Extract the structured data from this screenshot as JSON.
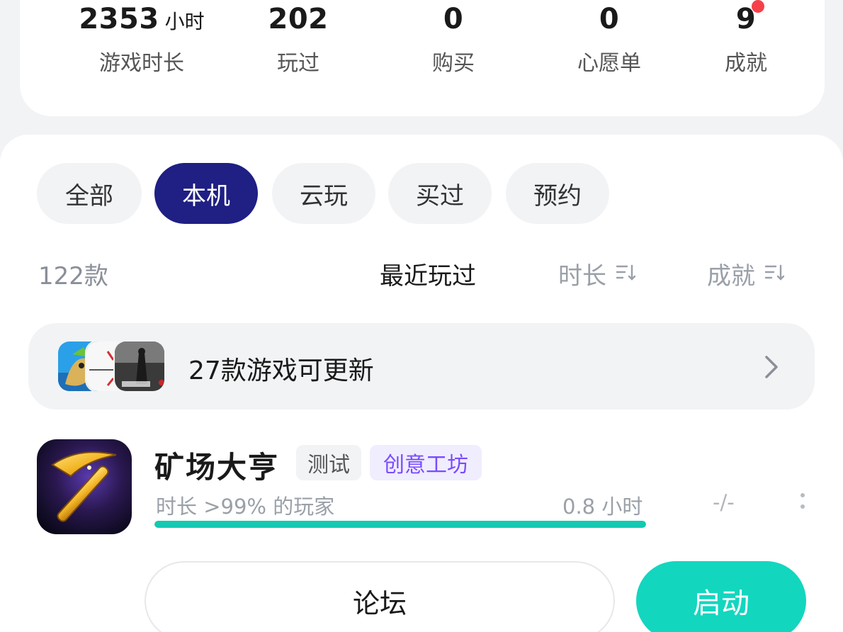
{
  "stats": [
    {
      "value": "2353",
      "unit": "小时",
      "label": "游戏时长"
    },
    {
      "value": "202",
      "unit": "",
      "label": "玩过"
    },
    {
      "value": "0",
      "unit": "",
      "label": "购买"
    },
    {
      "value": "0",
      "unit": "",
      "label": "心愿单"
    },
    {
      "value": "9",
      "unit": "",
      "label": "成就",
      "has_notification_dot": true
    }
  ],
  "tabs": [
    {
      "label": "全部",
      "active": false
    },
    {
      "label": "本机",
      "active": true
    },
    {
      "label": "云玩",
      "active": false
    },
    {
      "label": "买过",
      "active": false
    },
    {
      "label": "预约",
      "active": false
    }
  ],
  "list_header": {
    "count": "122款",
    "sort_options": [
      {
        "label": "最近玩过",
        "active": true,
        "icon": ""
      },
      {
        "label": "时长",
        "active": false,
        "icon": "sort-icon"
      },
      {
        "label": "成就",
        "active": false,
        "icon": "sort-icon"
      }
    ]
  },
  "update_banner": {
    "text": "27款游戏可更新",
    "thumbnail_icons": [
      "game-thumb-1",
      "game-thumb-2",
      "game-thumb-3"
    ],
    "arrow_icon": "chevron-right-icon"
  },
  "game": {
    "title": "矿场大亨",
    "icon": "pickaxe-icon",
    "tags": [
      "测试",
      "创意工坊"
    ],
    "rank_text": "时长 >99% 的玩家",
    "hours": "0.8 小时",
    "achievements": "-/-",
    "progress_fraction": 1.0,
    "more_icon": "more-vertical-icon",
    "forum_button": "论坛",
    "launch_button": "启动"
  },
  "colors": {
    "active_tab": "#1f1f84",
    "accent_teal": "#13d6bf",
    "progress": "#13c9b2",
    "workshop_tag_text": "#7a4bff",
    "notification_dot": "#f5404a"
  }
}
